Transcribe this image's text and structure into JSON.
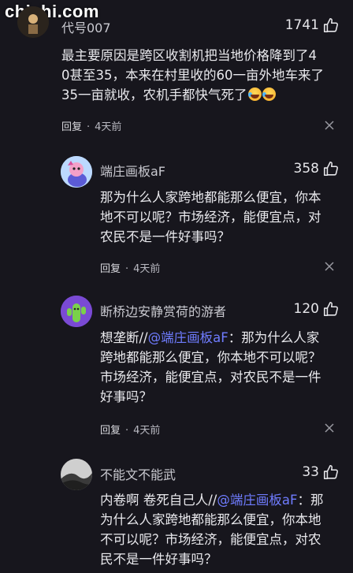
{
  "watermark": "chishi.com",
  "comments": [
    {
      "username": "代号007",
      "likes": "1741",
      "text_lines": [
        "最主要原因是跨区收割机把当地价格降到了4",
        "0甚至35，本来在村里收的60一亩外地车来了",
        "35一亩就收，农机手都快气死了"
      ],
      "emoji_names": [
        "laughing-crying-emoji",
        "laughing-crying-emoji"
      ],
      "reply_label": "回复",
      "time": "4天前"
    },
    {
      "username": "端庄画板aF",
      "likes": "358",
      "text_lines": [
        "那为什么人家跨地都能那么便宜，你本",
        "地不可以呢？市场经济，能便宜点，对",
        "农民不是一件好事吗？"
      ],
      "reply_label": "回复",
      "time": "4天前"
    },
    {
      "username": "断桥边安静赏荷的游者",
      "likes": "120",
      "prefix": "想垄断//",
      "mention": "@端庄画板aF",
      "after_mention": "：那为什么人家",
      "rest_lines": [
        "跨地都能那么便宜，你本地不可以呢？",
        "市场经济，能便宜点，对农民不是一件",
        "好事吗？"
      ],
      "reply_label": "回复",
      "time": "4天前"
    },
    {
      "username": "不能文不能武",
      "likes": "33",
      "prefix": "内卷啊 卷死自己人//",
      "mention": "@端庄画板aF",
      "after_mention": "：那",
      "rest_lines": [
        "为什么人家跨地都能那么便宜，你本地",
        "不可以呢？市场经济，能便宜点，对农",
        "民不是一件好事吗？"
      ]
    }
  ],
  "colors": {
    "background": "#17161d",
    "mention": "#6f7cff",
    "text": "#e9e9ed",
    "muted": "#b9b9c1"
  },
  "icons": {
    "like": "thumbs-up-outline-icon",
    "dismiss": "close-icon"
  }
}
